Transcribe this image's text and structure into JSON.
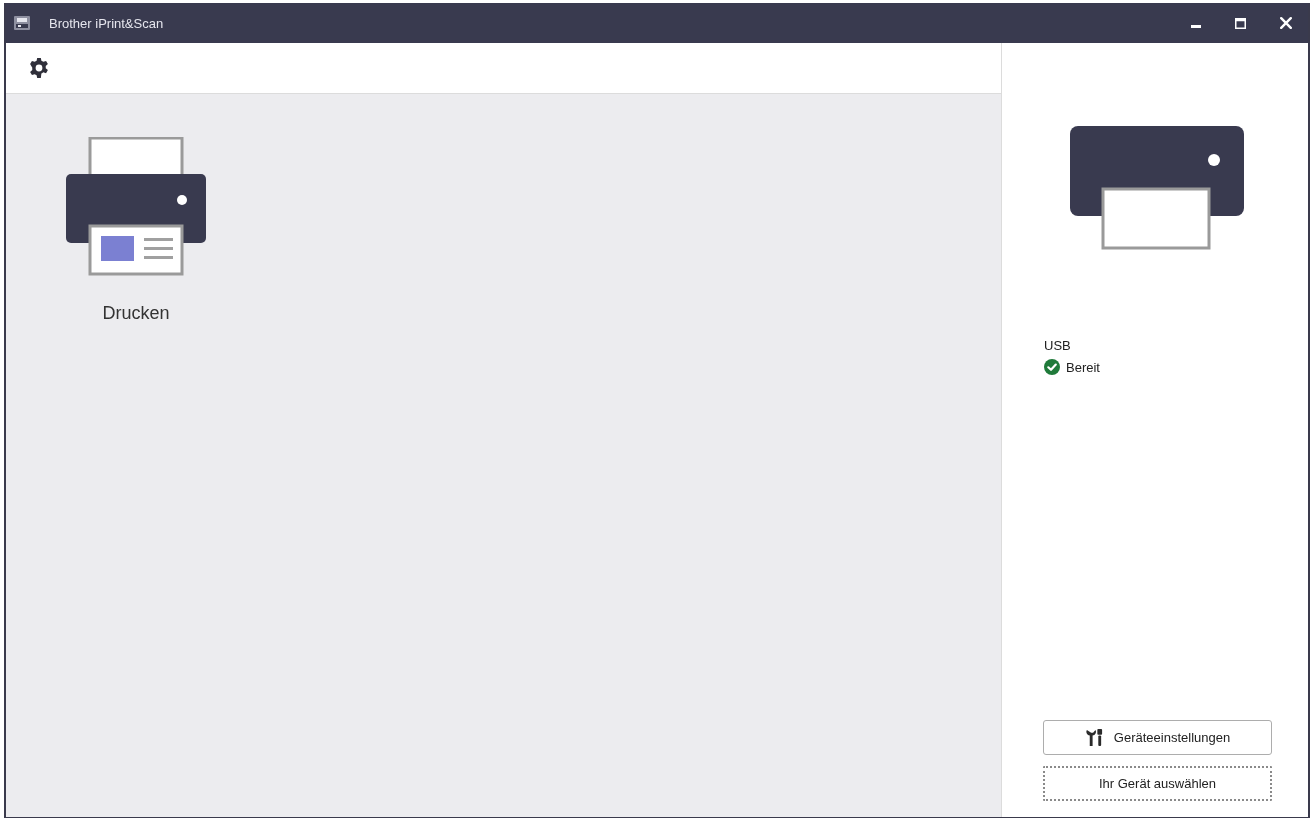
{
  "window": {
    "title": "Brother iPrint&Scan"
  },
  "functions": [
    {
      "label": "Drucken"
    }
  ],
  "device": {
    "connection": "USB",
    "status": "Bereit"
  },
  "buttons": [
    {
      "label": "Geräteeinstellungen",
      "kind": "settings",
      "focused": false
    },
    {
      "label": "Ihr Gerät auswählen",
      "kind": "plain",
      "focused": true
    }
  ]
}
